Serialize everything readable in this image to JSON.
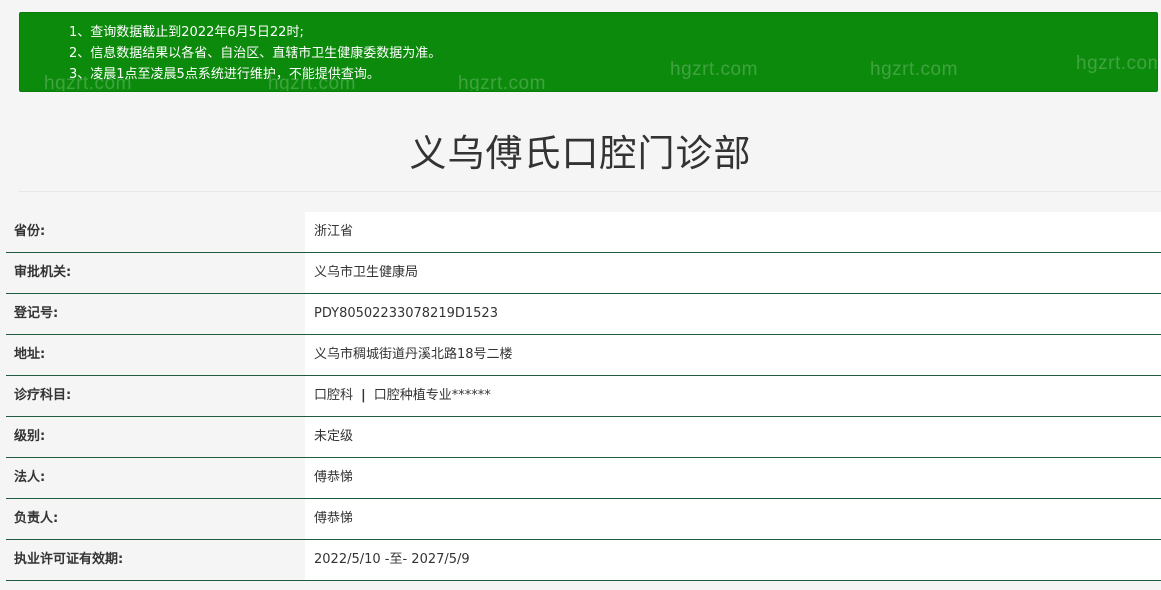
{
  "notice": {
    "lines": [
      "1、查询数据截止到2022年6月5日22时;",
      "2、信息数据结果以各省、自治区、直辖市卫生健康委数据为准。",
      "3、凌晨1点至凌晨5点系统进行维护，不能提供查询。"
    ],
    "background_color": "#0b8a0b"
  },
  "watermark_text": "hgzrt.com",
  "page": {
    "title": "义乌傅氏口腔门诊部"
  },
  "info": {
    "rows": [
      {
        "label": "省份:",
        "value": "浙江省"
      },
      {
        "label": "审批机关:",
        "value": "义乌市卫生健康局"
      },
      {
        "label": "登记号:",
        "value": "PDY80502233078219D1523"
      },
      {
        "label": "地址:",
        "value": "义乌市稠城街道丹溪北路18号二楼"
      },
      {
        "label": "诊疗科目:",
        "value_parts": [
          "口腔科",
          "|",
          "口腔种植专业******"
        ]
      },
      {
        "label": "级别:",
        "value": "未定级"
      },
      {
        "label": "法人:",
        "value": "傅恭悌"
      },
      {
        "label": "负责人:",
        "value": "傅恭悌"
      },
      {
        "label": "执业许可证有效期:",
        "value": "2022/5/10 -至- 2027/5/9"
      }
    ],
    "row_border_color": "#1f5c3f"
  }
}
